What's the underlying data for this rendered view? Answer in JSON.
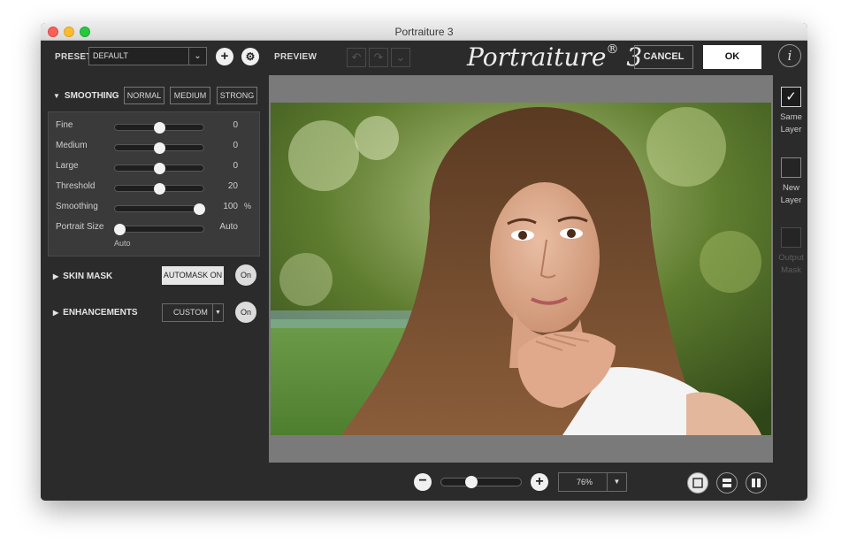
{
  "window": {
    "title": "Portraiture 3"
  },
  "toolbar": {
    "preset_label": "PRESET",
    "preset_value": "DEFAULT",
    "preview_label": "PREVIEW",
    "logo_text": "Portraiture",
    "logo_mark": "®",
    "logo_version": "3",
    "cancel_label": "CANCEL",
    "ok_label": "OK",
    "info_label": "i"
  },
  "smoothing": {
    "title": "SMOOTHING",
    "modes": [
      "NORMAL",
      "MEDIUM",
      "STRONG"
    ],
    "sliders": [
      {
        "name": "Fine",
        "value": "0",
        "position": 0.5,
        "unit": ""
      },
      {
        "name": "Medium",
        "value": "0",
        "position": 0.5,
        "unit": ""
      },
      {
        "name": "Large",
        "value": "0",
        "position": 0.5,
        "unit": ""
      },
      {
        "name": "Threshold",
        "value": "20",
        "position": 0.5,
        "unit": ""
      },
      {
        "name": "Smoothing",
        "value": "100",
        "position": 0.95,
        "unit": "%"
      },
      {
        "name": "Portrait Size",
        "value": "Auto",
        "position": 0.05,
        "unit": ""
      }
    ],
    "portrait_size_sub": "Auto"
  },
  "skin_mask": {
    "title": "SKIN MASK",
    "automask_label": "AUTOMASK ON",
    "toggle_label": "On"
  },
  "enhancements": {
    "title": "ENHANCEMENTS",
    "mode_value": "CUSTOM",
    "toggle_label": "On"
  },
  "output": {
    "same_layer": {
      "line1": "Same",
      "line2": "Layer"
    },
    "new_layer": {
      "line1": "New",
      "line2": "Layer"
    },
    "output_mask": {
      "line1": "Output",
      "line2": "Mask"
    }
  },
  "zoom": {
    "value": "76%",
    "slider_position": 0.38,
    "minus_label": "−",
    "plus_label": "+"
  },
  "colors": {
    "accent": "#ffffff",
    "panel": "#2b2b2b",
    "preview_bg": "#7a7a7a"
  }
}
